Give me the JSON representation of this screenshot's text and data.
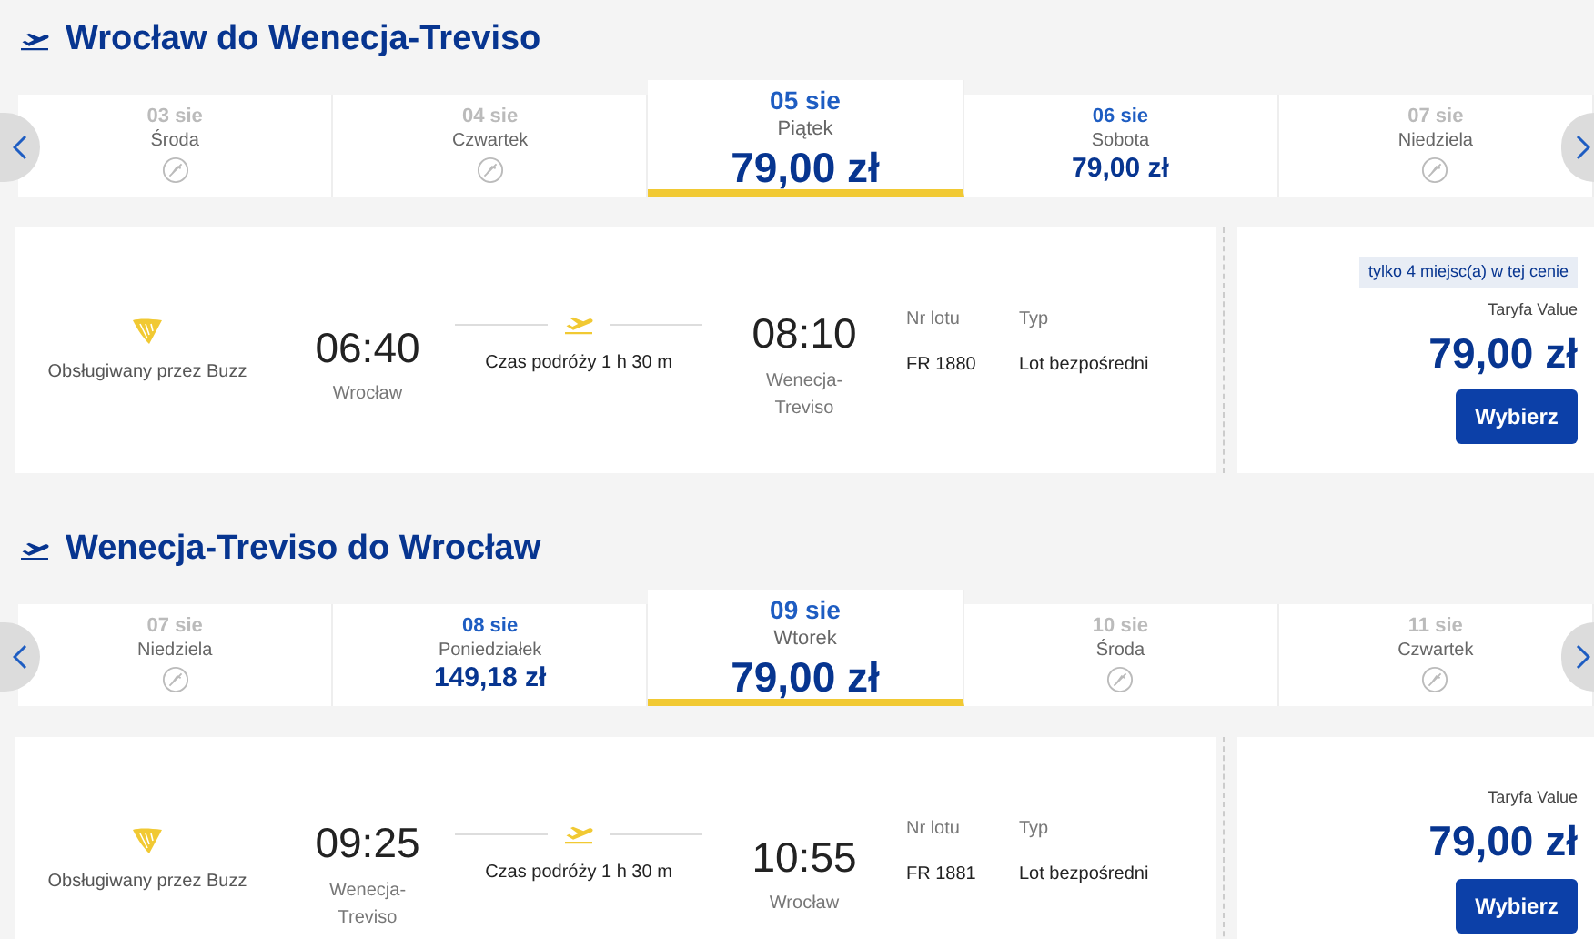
{
  "sections": [
    {
      "title": "Wrocław do Wenecja-Treviso",
      "dates": [
        {
          "date": "03 sie",
          "day": "Środa",
          "available": false,
          "selected": false
        },
        {
          "date": "04 sie",
          "day": "Czwartek",
          "available": false,
          "selected": false
        },
        {
          "date": "05 sie",
          "day": "Piątek",
          "available": true,
          "price": "79,00 zł",
          "selected": true
        },
        {
          "date": "06 sie",
          "day": "Sobota",
          "available": true,
          "price": "79,00 zł",
          "selected": false
        },
        {
          "date": "07 sie",
          "day": "Niedziela",
          "available": false,
          "selected": false
        }
      ],
      "flight": {
        "operator": "Obsługiwany przez Buzz",
        "depart_time": "06:40",
        "depart_city": "Wrocław",
        "duration": "Czas podróży 1 h 30 m",
        "arrive_time": "08:10",
        "arrive_city": "Wenecja-Treviso",
        "number_label": "Nr lotu",
        "number": "FR 1880",
        "type_label": "Typ",
        "type": "Lot bezpośredni",
        "seats_note": "tylko 4 miejsc(a) w tej cenie",
        "fare": "Taryfa Value",
        "price": "79,00 zł",
        "button": "Wybierz"
      }
    },
    {
      "title": "Wenecja-Treviso do Wrocław",
      "dates": [
        {
          "date": "07 sie",
          "day": "Niedziela",
          "available": false,
          "selected": false
        },
        {
          "date": "08 sie",
          "day": "Poniedziałek",
          "available": true,
          "price": "149,18 zł",
          "selected": false
        },
        {
          "date": "09 sie",
          "day": "Wtorek",
          "available": true,
          "price": "79,00 zł",
          "selected": true
        },
        {
          "date": "10 sie",
          "day": "Środa",
          "available": false,
          "selected": false
        },
        {
          "date": "11 sie",
          "day": "Czwartek",
          "available": false,
          "selected": false
        }
      ],
      "flight": {
        "operator": "Obsługiwany przez Buzz",
        "depart_time": "09:25",
        "depart_city": "Wenecja-Treviso",
        "duration": "Czas podróży 1 h 30 m",
        "arrive_time": "10:55",
        "arrive_city": "Wrocław",
        "number_label": "Nr lotu",
        "number": "FR 1881",
        "type_label": "Typ",
        "type": "Lot bezpośredni",
        "fare": "Taryfa Value",
        "price": "79,00 zł",
        "button": "Wybierz"
      }
    }
  ]
}
